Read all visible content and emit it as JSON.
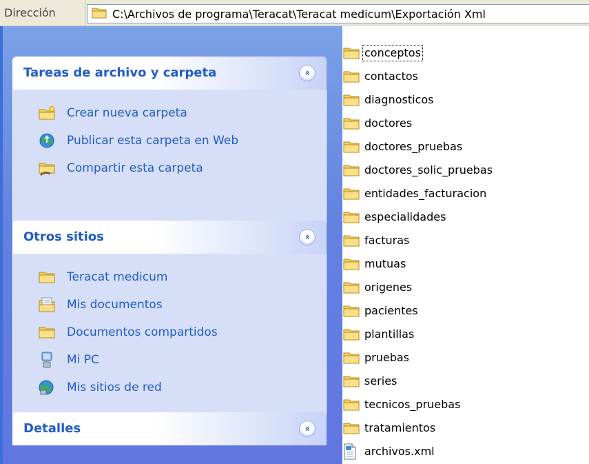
{
  "address": {
    "label": "Dirección",
    "path": "C:\\Archivos de programa\\Teracat\\Teracat medicum\\Exportación Xml",
    "icon": "folder-icon"
  },
  "panels": {
    "tasks": {
      "title": "Tareas de archivo y carpeta",
      "collapse_glyph": "»",
      "items": [
        {
          "label": "Crear nueva carpeta",
          "icon": "new-folder-icon"
        },
        {
          "label": "Publicar esta carpeta en Web",
          "icon": "globe-publish-icon"
        },
        {
          "label": "Compartir esta carpeta",
          "icon": "share-folder-icon"
        }
      ]
    },
    "places": {
      "title": "Otros sitios",
      "collapse_glyph": "»",
      "items": [
        {
          "label": "Teracat medicum",
          "icon": "folder-icon"
        },
        {
          "label": "Mis documentos",
          "icon": "documents-icon"
        },
        {
          "label": "Documentos compartidos",
          "icon": "folder-icon"
        },
        {
          "label": "Mi PC",
          "icon": "computer-icon"
        },
        {
          "label": "Mis sitios de red",
          "icon": "network-icon"
        }
      ]
    },
    "details": {
      "title": "Detalles",
      "collapse_glyph": "»"
    }
  },
  "files": [
    {
      "name": "conceptos",
      "type": "folder"
    },
    {
      "name": "contactos",
      "type": "folder"
    },
    {
      "name": "diagnosticos",
      "type": "folder"
    },
    {
      "name": "doctores",
      "type": "folder"
    },
    {
      "name": "doctores_pruebas",
      "type": "folder"
    },
    {
      "name": "doctores_solic_pruebas",
      "type": "folder"
    },
    {
      "name": "entidades_facturacion",
      "type": "folder"
    },
    {
      "name": "especialidades",
      "type": "folder"
    },
    {
      "name": "facturas",
      "type": "folder"
    },
    {
      "name": "mutuas",
      "type": "folder"
    },
    {
      "name": "origenes",
      "type": "folder"
    },
    {
      "name": "pacientes",
      "type": "folder"
    },
    {
      "name": "plantillas",
      "type": "folder"
    },
    {
      "name": "pruebas",
      "type": "folder"
    },
    {
      "name": "series",
      "type": "folder"
    },
    {
      "name": "tecnicos_pruebas",
      "type": "folder"
    },
    {
      "name": "tratamientos",
      "type": "folder"
    },
    {
      "name": "archivos.xml",
      "type": "xml"
    }
  ],
  "colors": {
    "pane_blue": "#6382e0",
    "link_blue": "#215dc6",
    "panel_body": "#d6dff7"
  }
}
